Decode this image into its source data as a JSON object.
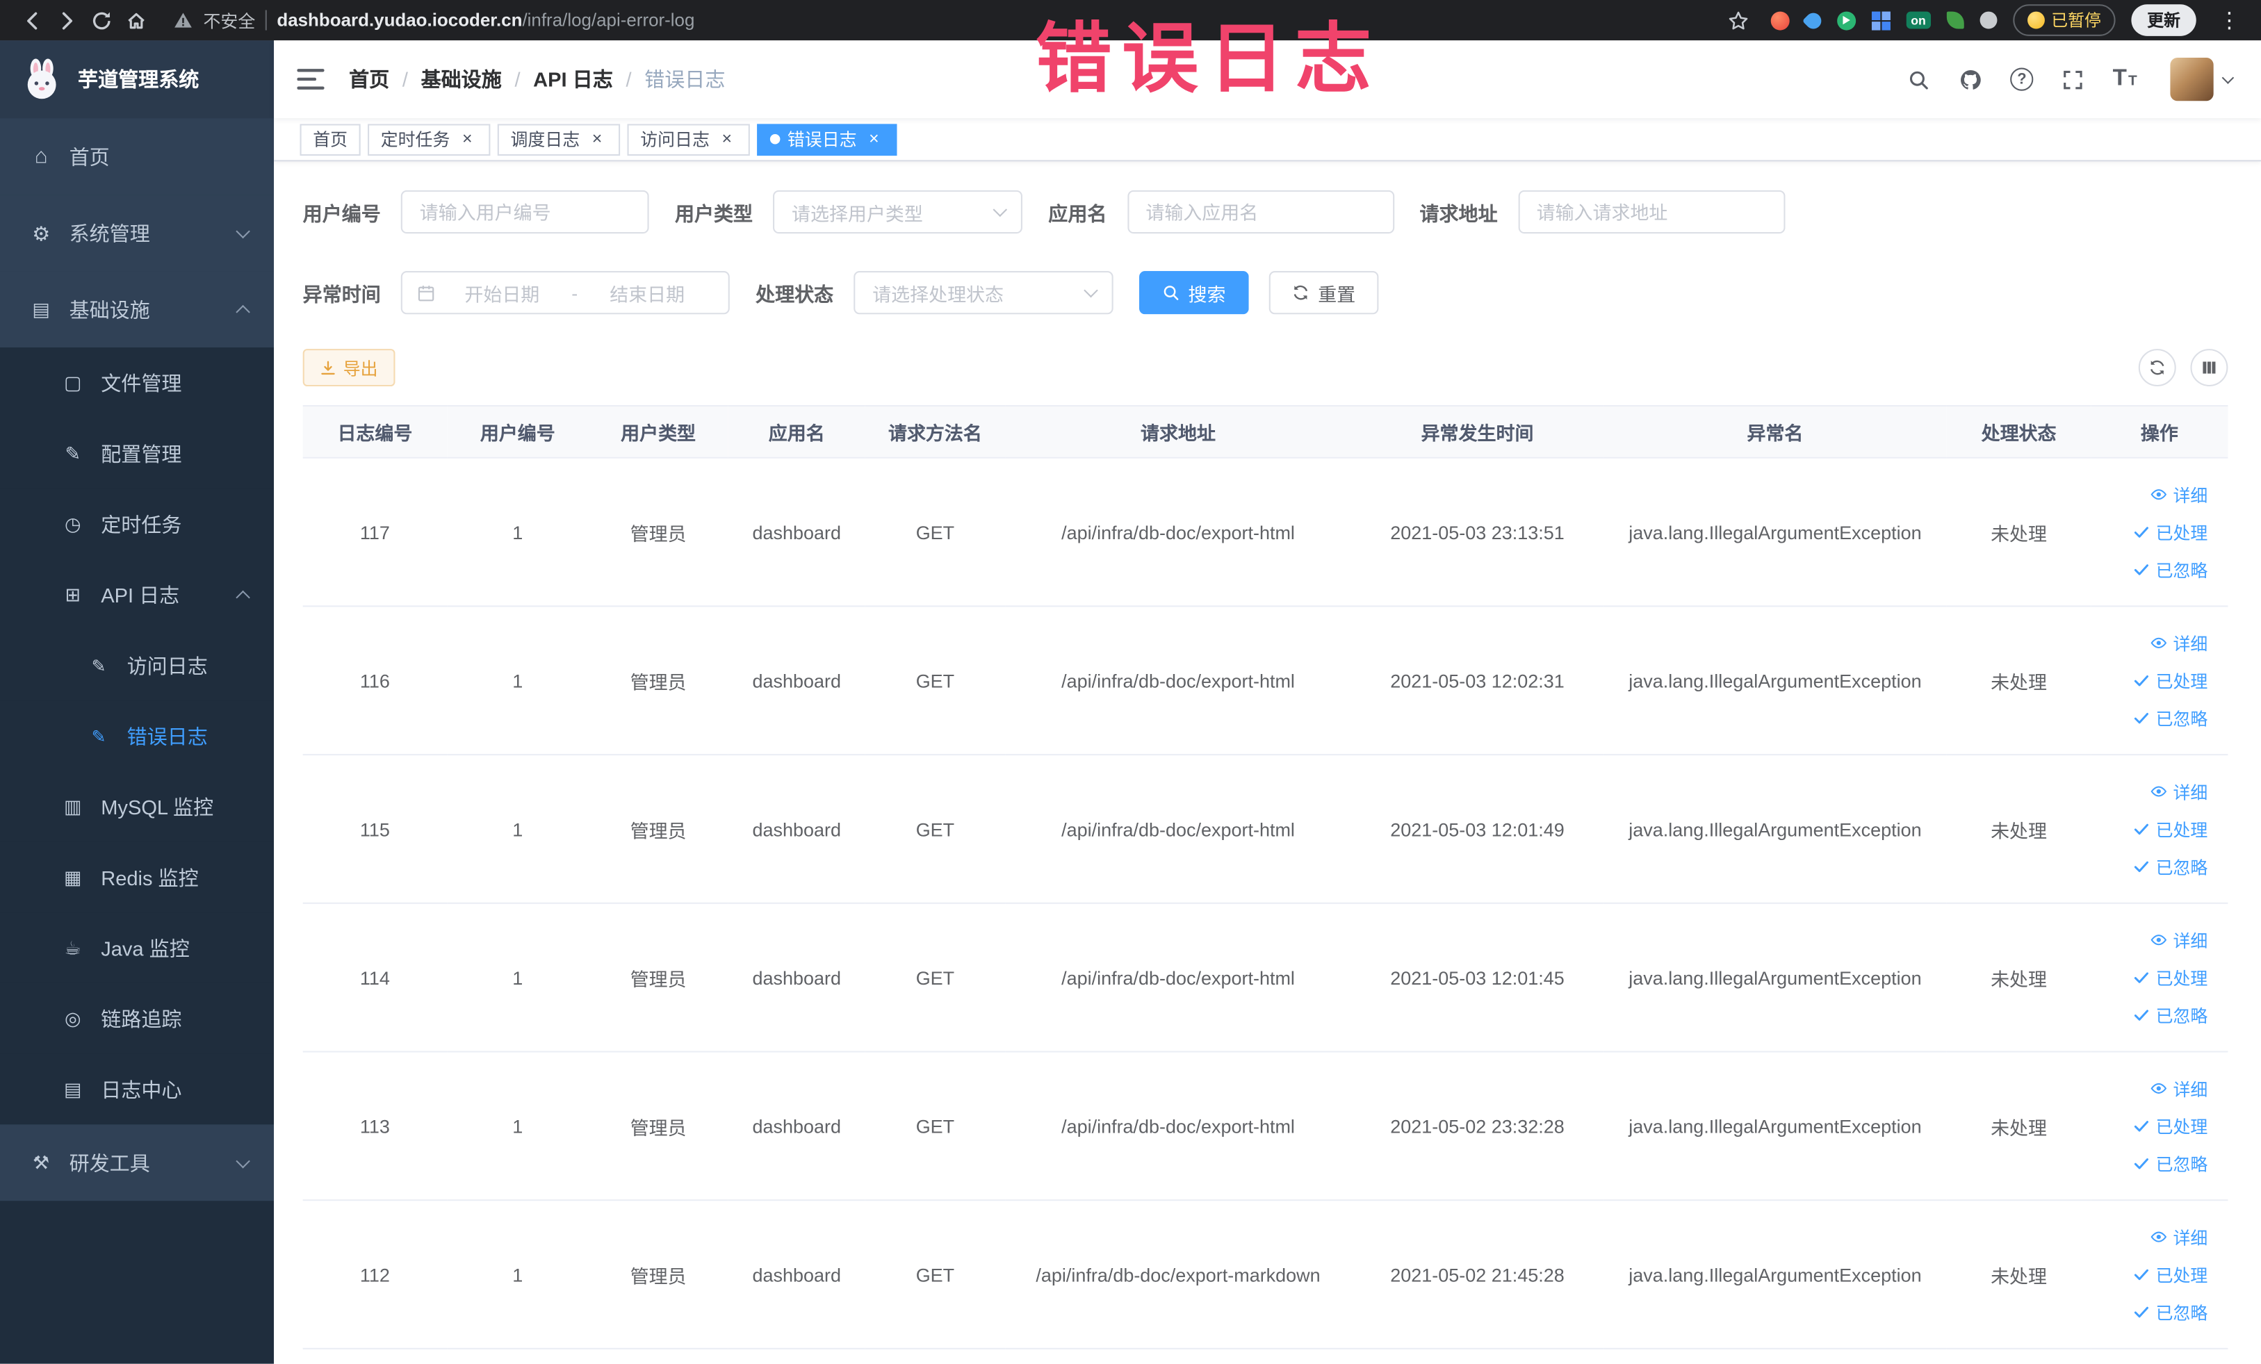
{
  "browser": {
    "security_label": "不安全",
    "url_domain": "dashboard.yudao.iocoder.cn",
    "url_path": "/infra/log/api-error-log",
    "extension_on_badge": "on",
    "paused_badge": "已暂停",
    "update_button": "更新"
  },
  "overlay": {
    "text": "错误日志"
  },
  "sidebar": {
    "title": "芋道管理系统",
    "menu": [
      {
        "label": "首页"
      },
      {
        "label": "系统管理"
      },
      {
        "label": "基础设施",
        "children": [
          {
            "label": "文件管理"
          },
          {
            "label": "配置管理"
          },
          {
            "label": "定时任务"
          },
          {
            "label": "API 日志",
            "children": [
              {
                "label": "访问日志"
              },
              {
                "label": "错误日志"
              }
            ]
          },
          {
            "label": "MySQL 监控"
          },
          {
            "label": "Redis 监控"
          },
          {
            "label": "Java 监控"
          },
          {
            "label": "链路追踪"
          },
          {
            "label": "日志中心"
          }
        ]
      },
      {
        "label": "研发工具"
      }
    ]
  },
  "navbar": {
    "breadcrumb": [
      "首页",
      "基础设施",
      "API 日志",
      "错误日志"
    ]
  },
  "tabs": [
    {
      "label": "首页"
    },
    {
      "label": "定时任务"
    },
    {
      "label": "调度日志"
    },
    {
      "label": "访问日志"
    },
    {
      "label": "错误日志"
    }
  ],
  "filters": {
    "user_id_label": "用户编号",
    "user_id_placeholder": "请输入用户编号",
    "user_type_label": "用户类型",
    "user_type_placeholder": "请选择用户类型",
    "app_name_label": "应用名",
    "app_name_placeholder": "请输入应用名",
    "request_url_label": "请求地址",
    "request_url_placeholder": "请输入请求地址",
    "exception_time_label": "异常时间",
    "date_start_placeholder": "开始日期",
    "date_separator": "-",
    "date_end_placeholder": "结束日期",
    "process_status_label": "处理状态",
    "process_status_placeholder": "请选择处理状态",
    "search_button": "搜索",
    "reset_button": "重置"
  },
  "toolbar": {
    "export_button": "导出"
  },
  "table": {
    "columns": [
      "日志编号",
      "用户编号",
      "用户类型",
      "应用名",
      "请求方法名",
      "请求地址",
      "异常发生时间",
      "异常名",
      "处理状态",
      "操作"
    ],
    "action_labels": {
      "detail": "详细",
      "processed": "已处理",
      "ignored": "已忽略"
    },
    "rows": [
      {
        "log_id": "117",
        "user_id": "1",
        "user_type": "管理员",
        "app_name": "dashboard",
        "method": "GET",
        "url": "/api/infra/db-doc/export-html",
        "time": "2021-05-03 23:13:51",
        "exception": "java.lang.IllegalArgumentException",
        "status": "未处理"
      },
      {
        "log_id": "116",
        "user_id": "1",
        "user_type": "管理员",
        "app_name": "dashboard",
        "method": "GET",
        "url": "/api/infra/db-doc/export-html",
        "time": "2021-05-03 12:02:31",
        "exception": "java.lang.IllegalArgumentException",
        "status": "未处理"
      },
      {
        "log_id": "115",
        "user_id": "1",
        "user_type": "管理员",
        "app_name": "dashboard",
        "method": "GET",
        "url": "/api/infra/db-doc/export-html",
        "time": "2021-05-03 12:01:49",
        "exception": "java.lang.IllegalArgumentException",
        "status": "未处理"
      },
      {
        "log_id": "114",
        "user_id": "1",
        "user_type": "管理员",
        "app_name": "dashboard",
        "method": "GET",
        "url": "/api/infra/db-doc/export-html",
        "time": "2021-05-03 12:01:45",
        "exception": "java.lang.IllegalArgumentException",
        "status": "未处理"
      },
      {
        "log_id": "113",
        "user_id": "1",
        "user_type": "管理员",
        "app_name": "dashboard",
        "method": "GET",
        "url": "/api/infra/db-doc/export-html",
        "time": "2021-05-02 23:32:28",
        "exception": "java.lang.IllegalArgumentException",
        "status": "未处理"
      },
      {
        "log_id": "112",
        "user_id": "1",
        "user_type": "管理员",
        "app_name": "dashboard",
        "method": "GET",
        "url": "/api/infra/db-doc/export-markdown",
        "time": "2021-05-02 21:45:28",
        "exception": "java.lang.IllegalArgumentException",
        "status": "未处理"
      }
    ]
  },
  "colors": {
    "accent": "#409eff",
    "warning": "#e6a23c",
    "sidebar_bg": "#1f2d3d",
    "sidebar_item_bg": "#304156",
    "annotation": "#f0436b",
    "chrome_bg": "#202124"
  }
}
